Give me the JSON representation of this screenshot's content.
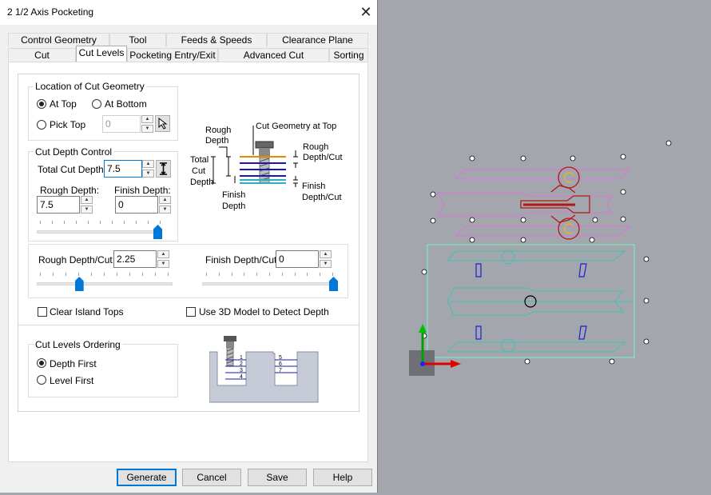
{
  "dialog": {
    "title": "2 1/2 Axis Pocketing",
    "tabs_row1": [
      "Control Geometry",
      "Tool",
      "Feeds & Speeds",
      "Clearance Plane"
    ],
    "tabs_row2": [
      "Cut Parameters",
      "Cut Levels",
      "Pocketing Entry/Exit",
      "Advanced Cut Parameters",
      "Sorting"
    ],
    "active_tab": "Cut Levels"
  },
  "location": {
    "group_label": "Location of Cut Geometry",
    "at_top": "At Top",
    "at_bottom": "At Bottom",
    "pick_top": "Pick Top",
    "pick_top_value": "0",
    "selected": "At Top"
  },
  "depth": {
    "group_label": "Cut Depth Control",
    "total_label": "Total Cut Depth:",
    "total_value": "7.5",
    "rough_label": "Rough Depth:",
    "rough_value": "7.5",
    "finish_label": "Finish Depth:",
    "finish_value": "0",
    "rough_slider": 1.0
  },
  "diagram": {
    "rough_depth": "Rough\nDepth",
    "cut_geometry": "Cut Geometry at Top",
    "total_cut_depth": "Total\nCut\nDepth",
    "finish_depth": "Finish\nDepth",
    "rough_depth_cut": "Rough\nDepth/Cut",
    "finish_depth_cut": "Finish\nDepth/Cut"
  },
  "per_cut": {
    "rough_label": "Rough Depth/Cut:",
    "rough_value": "2.25",
    "rough_slider": 0.3,
    "finish_label": "Finish Depth/Cut:",
    "finish_value": "0",
    "finish_slider": 1.0
  },
  "options": {
    "clear_island": "Clear Island Tops",
    "use_3d": "Use 3D Model to Detect Depth"
  },
  "ordering": {
    "group_label": "Cut Levels Ordering",
    "depth_first": "Depth First",
    "level_first": "Level First",
    "selected": "Depth First",
    "levels_left": [
      "1",
      "2",
      "3",
      "4"
    ],
    "levels_right": [
      "5",
      "6",
      "7"
    ]
  },
  "buttons": {
    "generate": "Generate",
    "cancel": "Cancel",
    "save": "Save",
    "help": "Help"
  },
  "colors": {
    "viewport_bg": "#a3a7ad",
    "accent": "#0078d7",
    "magenta_geometry": "#e070e0",
    "cyan_geometry": "#40c0b0",
    "red_geometry": "#b01818"
  }
}
